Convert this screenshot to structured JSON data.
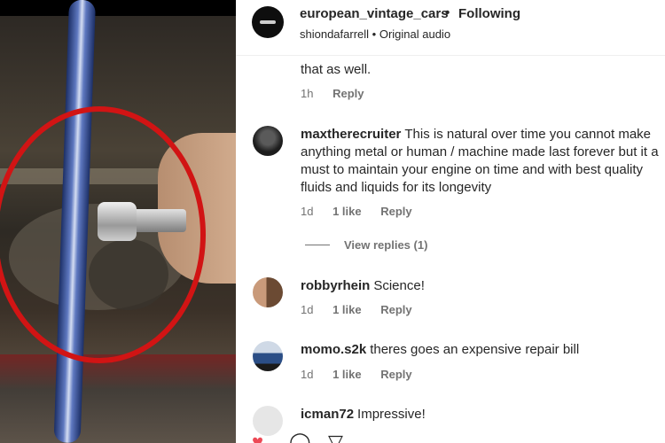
{
  "post": {
    "username": "european_vintage_cars",
    "separator": "•",
    "follow_label": "Following",
    "audio_user": "shiondafarrell",
    "audio_label": "Original audio"
  },
  "comments": [
    {
      "text": "that as well.",
      "time": "1h",
      "reply_label": "Reply"
    },
    {
      "username": "maxtherecruiter",
      "text": "This is natural over time you cannot make anything metal or human / machine made last forever but it a must to maintain your engine on time and with best quality fluids and liquids for its longevity",
      "time": "1d",
      "likes": "1 like",
      "reply_label": "Reply",
      "view_replies": "View replies (1)"
    },
    {
      "username": "robbyrhein",
      "text": "Science!",
      "time": "1d",
      "likes": "1 like",
      "reply_label": "Reply"
    },
    {
      "username": "momo.s2k",
      "text": "theres goes an expensive repair bill",
      "time": "1d",
      "likes": "1 like",
      "reply_label": "Reply"
    },
    {
      "username": "icman72",
      "text": "Impressive!"
    }
  ],
  "icons": [
    "heart-icon",
    "comment-icon",
    "share-icon"
  ],
  "colors": {
    "annotation_circle": "#d11414",
    "link_muted": "#737373"
  }
}
